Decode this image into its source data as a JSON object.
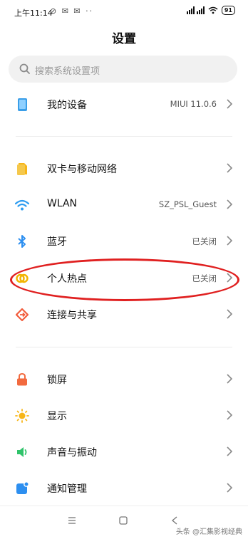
{
  "status_bar": {
    "time": "上午11:14",
    "battery": "91"
  },
  "header": {
    "title": "设置"
  },
  "search": {
    "placeholder": "搜索系统设置项"
  },
  "items": [
    {
      "label": "我的设备",
      "value": "MIUI 11.0.6",
      "icon": "device-icon"
    },
    {
      "label": "双卡与移动网络",
      "value": "",
      "icon": "sim-card-icon"
    },
    {
      "label": "WLAN",
      "value": "SZ_PSL_Guest",
      "icon": "wifi-icon"
    },
    {
      "label": "蓝牙",
      "value": "已关闭",
      "icon": "bluetooth-icon"
    },
    {
      "label": "个人热点",
      "value": "已关闭",
      "icon": "hotspot-icon"
    },
    {
      "label": "连接与共享",
      "value": "",
      "icon": "share-icon"
    },
    {
      "label": "锁屏",
      "value": "",
      "icon": "lock-icon"
    },
    {
      "label": "显示",
      "value": "",
      "icon": "sun-icon"
    },
    {
      "label": "声音与振动",
      "value": "",
      "icon": "speaker-icon"
    },
    {
      "label": "通知管理",
      "value": "",
      "icon": "notification-icon"
    }
  ],
  "colors": {
    "device": "#3a9ee8",
    "sim": "#f7b618",
    "wifi": "#2d9cf0",
    "bluetooth": "#2d8ff0",
    "hotspot": "#f2b400",
    "share": "#f25c3c",
    "lock": "#f26a3f",
    "sun": "#f7b618",
    "speaker": "#2fc36a",
    "notification": "#2d8ff0",
    "annotation": "#e02020"
  },
  "watermark": "头条 @汇集影视经典"
}
